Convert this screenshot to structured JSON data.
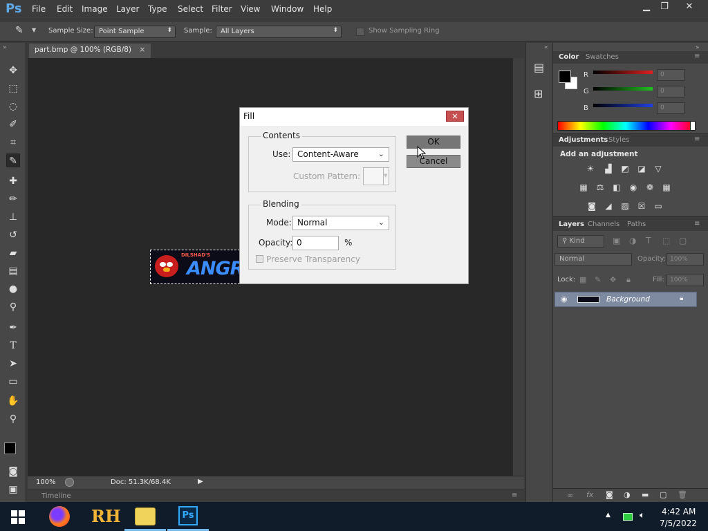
{
  "app": {
    "logo": "Ps"
  },
  "menu": [
    "File",
    "Edit",
    "Image",
    "Layer",
    "Type",
    "Select",
    "Filter",
    "View",
    "Window",
    "Help"
  ],
  "window_controls": {
    "minimize": "▁",
    "restore": "❐",
    "close": "✕"
  },
  "options": {
    "sample_size_label": "Sample Size:",
    "sample_size_value": "Point Sample",
    "sample_label": "Sample:",
    "sample_value": "All Layers",
    "show_ring_label": "Show Sampling Ring"
  },
  "document": {
    "tab_title": "part.bmp @ 100% (RGB/8)",
    "tab_close": "×"
  },
  "canvas_image": {
    "small_text": "DILSHAD'S",
    "big_text": "ANGR"
  },
  "status": {
    "zoom": "100%",
    "doc": "Doc: 51.3K/68.4K"
  },
  "timeline": {
    "label": "Timeline"
  },
  "fill_dialog": {
    "title": "Fill",
    "close": "✕",
    "contents_legend": "Contents",
    "use_label": "Use:",
    "use_value": "Content-Aware",
    "custom_pattern_label": "Custom Pattern:",
    "blending_legend": "Blending",
    "mode_label": "Mode:",
    "mode_value": "Normal",
    "opacity_label": "Opacity:",
    "opacity_value": "0",
    "opacity_unit": "%",
    "preserve_label": "Preserve Transparency",
    "ok": "OK",
    "cancel": "Cancel"
  },
  "color_panel": {
    "tabs": [
      "Color",
      "Swatches"
    ],
    "channels": [
      {
        "label": "R",
        "value": "0",
        "color": "#e02020"
      },
      {
        "label": "G",
        "value": "0",
        "color": "#20c020"
      },
      {
        "label": "B",
        "value": "0",
        "color": "#2040e0"
      }
    ]
  },
  "adjustments_panel": {
    "tabs": [
      "Adjustments",
      "Styles"
    ],
    "heading": "Add an adjustment"
  },
  "layers_panel": {
    "tabs": [
      "Layers",
      "Channels",
      "Paths"
    ],
    "kind_label": "Kind",
    "blend_mode": "Normal",
    "opacity_label": "Opacity:",
    "opacity_value": "100%",
    "lock_label": "Lock:",
    "fill_label": "Fill:",
    "fill_value": "100%",
    "layers": [
      {
        "name": "Background"
      }
    ]
  },
  "taskbar": {
    "rh_label": "RH",
    "ps_label": "Ps",
    "time": "4:42 AM",
    "date": "7/5/2022"
  }
}
